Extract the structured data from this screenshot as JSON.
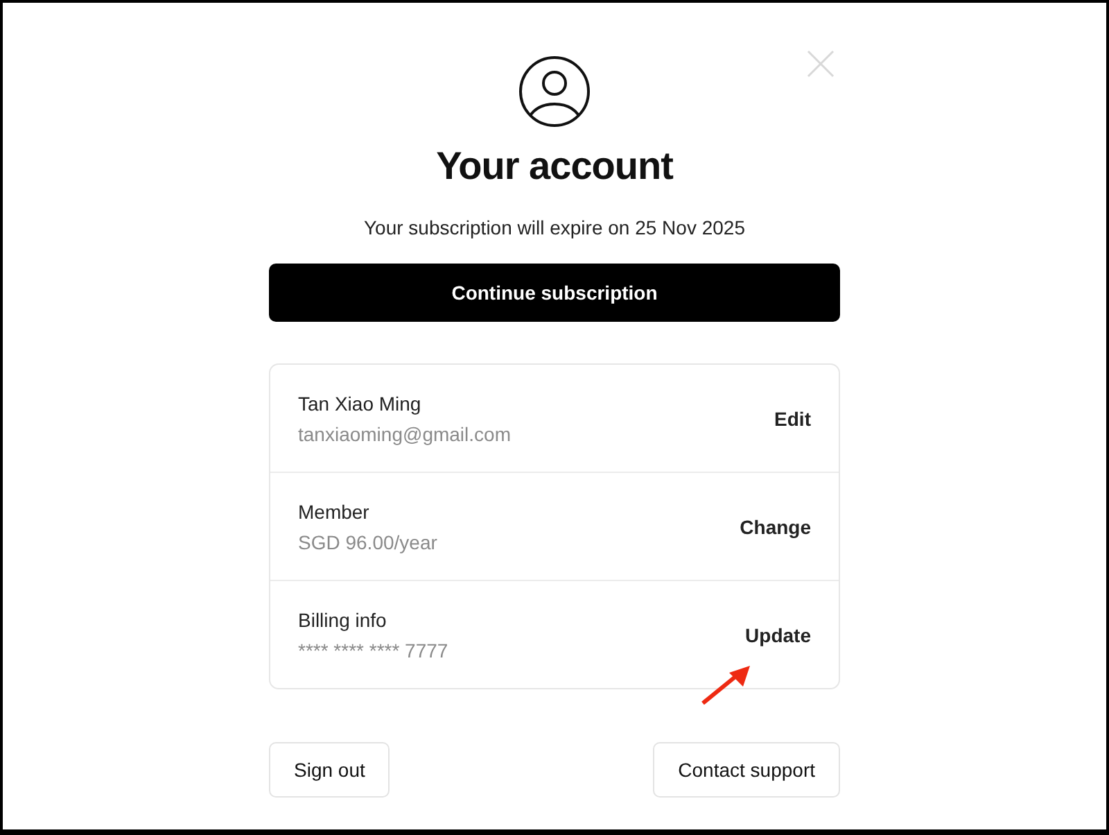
{
  "title": "Your account",
  "subtitle": "Your subscription will expire on 25 Nov 2025",
  "primary_button": "Continue subscription",
  "rows": [
    {
      "title": "Tan Xiao Ming",
      "detail": "tanxiaoming@gmail.com",
      "action": "Edit"
    },
    {
      "title": "Member",
      "detail": "SGD 96.00/year",
      "action": "Change"
    },
    {
      "title": "Billing info",
      "detail": "**** **** **** 7777",
      "action": "Update"
    }
  ],
  "footer_buttons": [
    "Sign out",
    "Contact support"
  ]
}
